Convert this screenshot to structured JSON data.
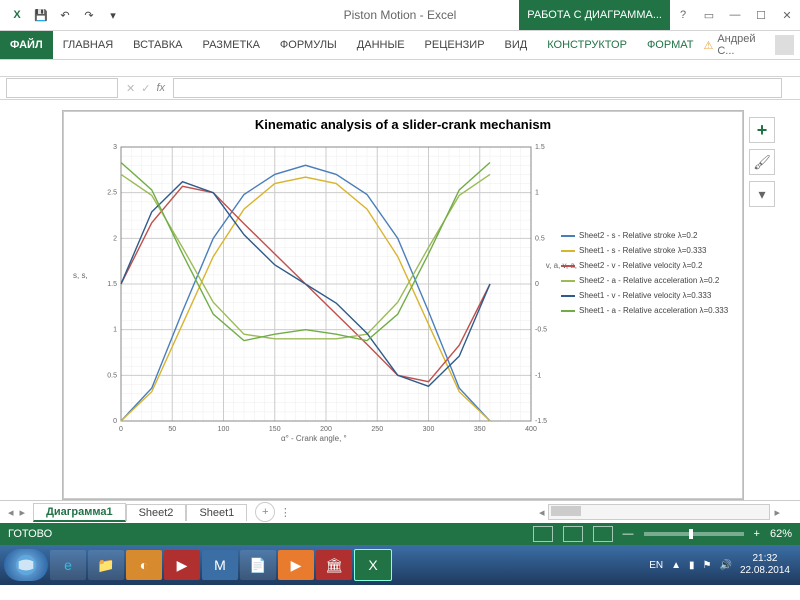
{
  "window": {
    "title": "Piston Motion - Excel",
    "context_tab": "РАБОТА С ДИАГРАММА..."
  },
  "ribbon": {
    "file": "ФАЙЛ",
    "tabs": [
      "ГЛАВНАЯ",
      "ВСТАВКА",
      "РАЗМЕТКА",
      "ФОРМУЛЫ",
      "ДАННЫЕ",
      "РЕЦЕНЗИР",
      "ВИД",
      "КОНСТРУКТОР",
      "ФОРМАТ"
    ],
    "user": "Андрей С..."
  },
  "sheets": {
    "active": "Диаграмма1",
    "others": [
      "Sheet2",
      "Sheet1"
    ]
  },
  "status": {
    "ready": "ГОТОВО",
    "zoom": "62%",
    "lang": "EN"
  },
  "clock": {
    "time": "21:32",
    "date": "22.08.2014"
  },
  "chart_data": {
    "type": "line",
    "title": "Kinematic analysis of a slider-crank mechanism",
    "xlabel": "α° - Crank angle, °",
    "ylabel_left": "s, s,",
    "ylabel_right": "v, a, v, a,",
    "xlim": [
      0,
      400
    ],
    "ylim_left": [
      0,
      3
    ],
    "ylim_right": [
      -1.5,
      1.5
    ],
    "xticks": [
      0,
      50,
      100,
      150,
      200,
      250,
      300,
      350,
      400
    ],
    "yticks_left": [
      0,
      0.5,
      1,
      1.5,
      2,
      2.5,
      3
    ],
    "yticks_right": [
      -1.5,
      -1,
      -0.5,
      0,
      0.5,
      1,
      1.5
    ],
    "x": [
      0,
      30,
      60,
      90,
      120,
      150,
      180,
      210,
      240,
      270,
      300,
      330,
      360
    ],
    "series": [
      {
        "name": "Sheet2 - s - Relative stroke λ=0.2",
        "axis": "left",
        "color": "#4a7ebb",
        "values": [
          0.0,
          0.36,
          1.2,
          2.0,
          2.48,
          2.7,
          2.8,
          2.7,
          2.48,
          2.0,
          1.2,
          0.36,
          0.0
        ]
      },
      {
        "name": "Sheet1 - s - Relative stroke λ=0.333",
        "axis": "left",
        "color": "#d9b430",
        "values": [
          0.0,
          0.32,
          1.06,
          1.8,
          2.32,
          2.6,
          2.67,
          2.6,
          2.32,
          1.8,
          1.06,
          0.32,
          0.0
        ]
      },
      {
        "name": "Sheet2 - v - Relative velocity λ=0.2",
        "axis": "right",
        "color": "#c0504d",
        "values": [
          0.0,
          0.67,
          1.07,
          1.0,
          0.66,
          0.33,
          0.0,
          -0.33,
          -0.66,
          -1.0,
          -1.07,
          -0.67,
          0.0
        ]
      },
      {
        "name": "Sheet2 - a - Relative acceleration λ=0.2",
        "axis": "right",
        "color": "#9bbb59",
        "values": [
          1.2,
          0.97,
          0.4,
          -0.2,
          -0.55,
          -0.6,
          -0.6,
          -0.6,
          -0.55,
          -0.2,
          0.4,
          0.97,
          1.2
        ]
      },
      {
        "name": "Sheet1 - v - Relative velocity λ=0.333",
        "axis": "right",
        "color": "#2e5b8a",
        "values": [
          0.0,
          0.79,
          1.12,
          1.0,
          0.54,
          0.21,
          0.0,
          -0.21,
          -0.54,
          -1.0,
          -1.12,
          -0.79,
          0.0
        ]
      },
      {
        "name": "Sheet1 - a - Relative acceleration λ=0.333",
        "axis": "right",
        "color": "#70ad47",
        "values": [
          1.33,
          1.03,
          0.33,
          -0.33,
          -0.62,
          -0.55,
          -0.5,
          -0.55,
          -0.62,
          -0.33,
          0.33,
          1.03,
          1.33
        ]
      }
    ]
  }
}
